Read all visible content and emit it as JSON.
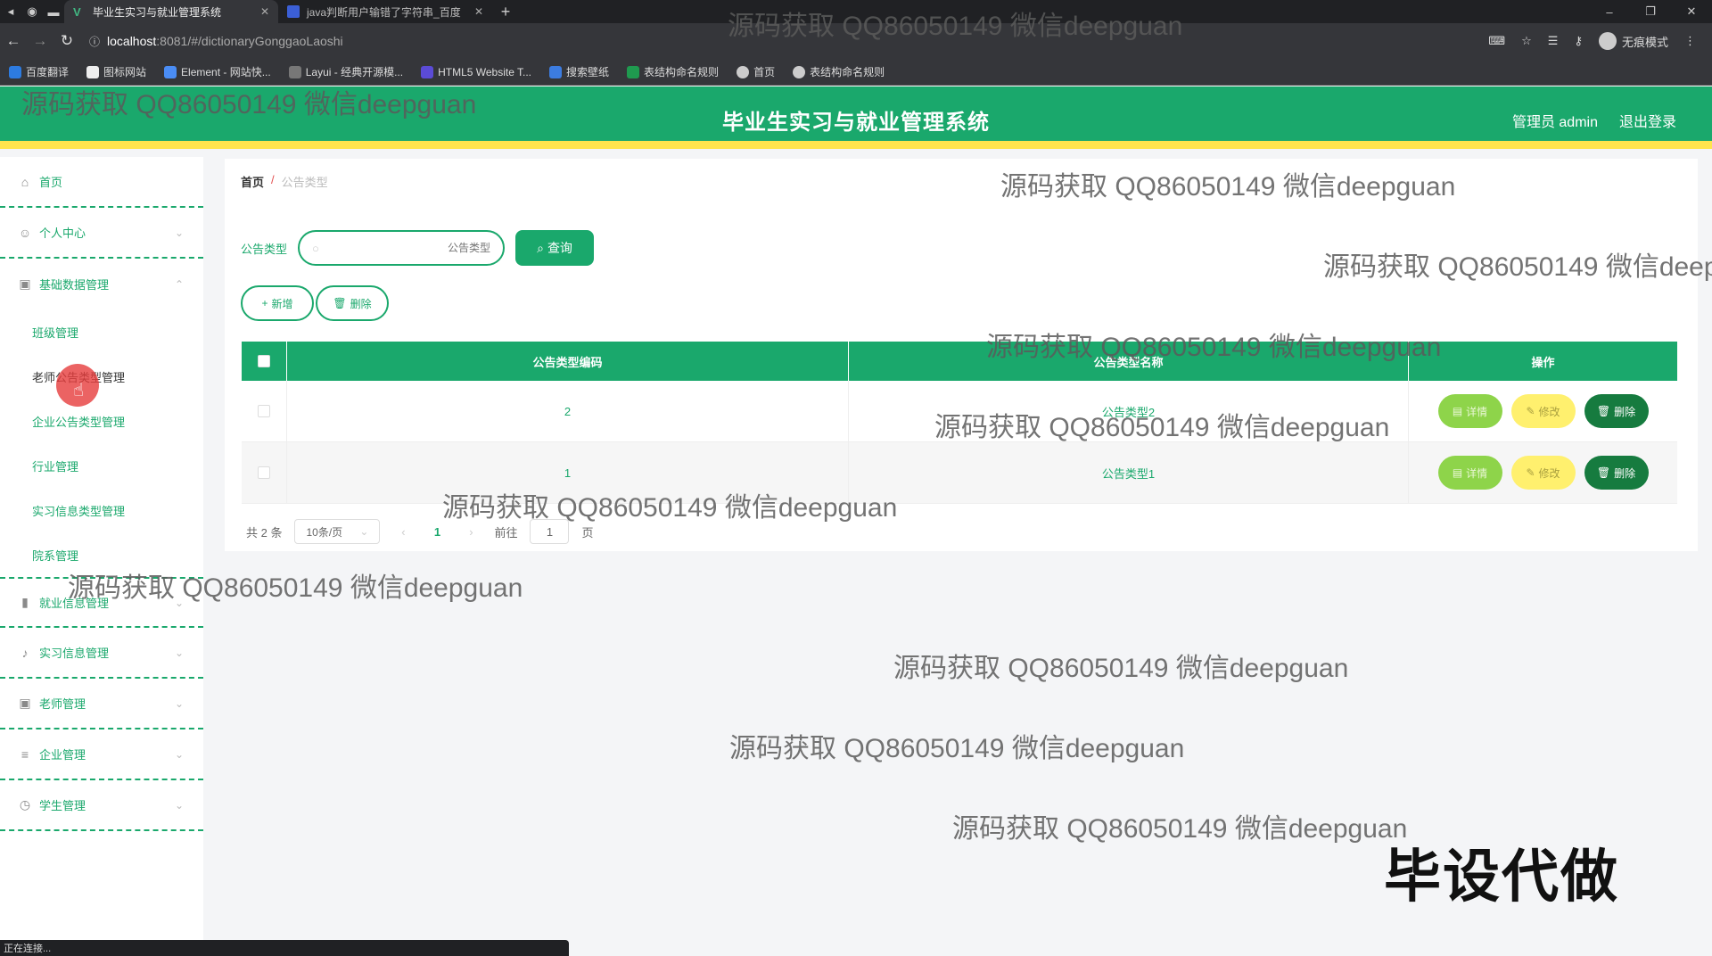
{
  "browser": {
    "tabs": [
      {
        "title": "毕业生实习与就业管理系统",
        "active": true
      },
      {
        "title": "java判断用户输错了字符串_百度",
        "active": false
      }
    ],
    "url_host": "localhost",
    "url_path": ":8081/#/dictionaryGonggaoLaoshi",
    "incognito_label": "无痕模式",
    "bookmarks": [
      "百度翻译",
      "图标网站",
      "Element - 网站快...",
      "Layui - 经典开源模...",
      "HTML5 Website T...",
      "搜索壁纸",
      "表结构命名规则",
      "首页",
      "表结构命名规则"
    ],
    "status_text": "正在连接..."
  },
  "header": {
    "title": "毕业生实习与就业管理系统",
    "user_label": "管理员 admin",
    "logout_label": "退出登录",
    "accent_color": "#1aa86c",
    "stripe_color": "#ffe44d"
  },
  "sidebar": {
    "home": "首页",
    "personal": "个人中心",
    "basic_data": "基础数据管理",
    "sub_items": [
      "班级管理",
      "老师公告类型管理",
      "企业公告类型管理",
      "行业管理",
      "实习信息类型管理",
      "院系管理"
    ],
    "employment": "就业信息管理",
    "internship": "实习信息管理",
    "teacher": "老师管理",
    "company": "企业管理",
    "student": "学生管理"
  },
  "breadcrumb": {
    "home": "首页",
    "separator": "/",
    "current": "公告类型"
  },
  "search": {
    "label": "公告类型",
    "placeholder": "公告类型",
    "query_label": "查询"
  },
  "actions": {
    "add_label": "新增",
    "delete_label": "删除"
  },
  "table": {
    "headers": [
      "公告类型编码",
      "公告类型名称",
      "操作"
    ],
    "rows": [
      {
        "code": "2",
        "name": "公告类型2"
      },
      {
        "code": "1",
        "name": "公告类型1"
      }
    ],
    "detail_label": "详情",
    "edit_label": "修改",
    "delete_label": "删除"
  },
  "pagination": {
    "total": "共 2 条",
    "page_size": "10条/页",
    "current_page": "1",
    "goto_label": "前往",
    "goto_value": "1",
    "page_suffix": "页"
  },
  "watermark": {
    "text": "源码获取 QQ86050149 微信deepguan",
    "big_text": "毕设代做"
  }
}
